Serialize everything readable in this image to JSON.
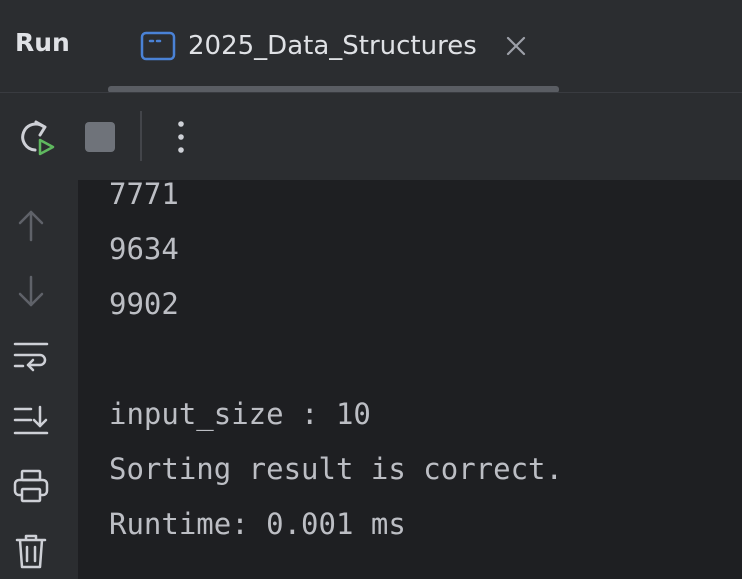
{
  "header": {
    "title": "Run",
    "tab": {
      "label": "2025_Data_Structures",
      "icon": "console-window-icon",
      "close_icon": "close-icon"
    }
  },
  "toolbar": {
    "buttons": [
      {
        "name": "rerun",
        "icon": "rerun-icon"
      },
      {
        "name": "stop",
        "icon": "stop-icon"
      },
      {
        "name": "more",
        "icon": "more-vertical-icon"
      }
    ]
  },
  "sidebar": {
    "icons": [
      "arrow-up-icon",
      "arrow-down-icon",
      "soft-wrap-icon",
      "scroll-to-end-icon",
      "print-icon",
      "trash-icon"
    ]
  },
  "console": {
    "lines": [
      "7771",
      "9634",
      "9902",
      "",
      "input_size : 10",
      "Sorting result is correct.",
      "Runtime: 0.001 ms"
    ]
  },
  "colors": {
    "panel_bg": "#2b2d30",
    "console_bg": "#1e1f22",
    "text": "#bcbec4",
    "rerun_accent": "#5fb85f",
    "tab_icon": "#4a82d6"
  }
}
